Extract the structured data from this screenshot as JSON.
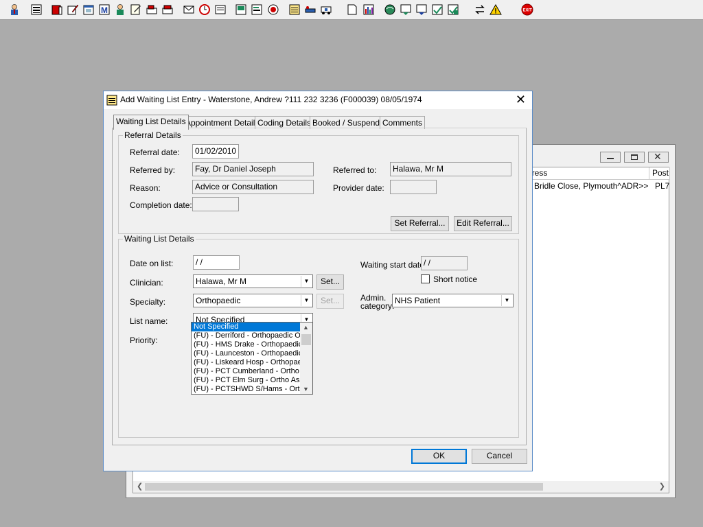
{
  "toolbar": {
    "icons": [
      "patient-icon",
      "print-icon",
      "book-icon",
      "note-edit-icon",
      "calendar-icon",
      "m-icon",
      "doctor-icon",
      "form-icon",
      "fax-icon",
      "phone-icon",
      "envelope-icon",
      "clock-icon",
      "tray-icon",
      "screen-icon",
      "document-icon",
      "record-icon",
      "list-icon",
      "bed-icon",
      "ambulance-icon",
      "page-icon",
      "bar-chart-icon",
      "globe-icon",
      "report-icon",
      "checklist-icon",
      "transfer-icon",
      "swap-icon",
      "warning-icon",
      "exit-icon"
    ],
    "exit_label": "EXIT"
  },
  "background_window": {
    "columns": [
      "dress",
      "Post"
    ],
    "row": {
      "address": "Bridle Close, Plymouth^ADR>>",
      "postcode": "PL7"
    }
  },
  "dialog": {
    "title": "Add Waiting List Entry - Waterstone, Andrew ?111 232 3236 (F000039) 08/05/1974",
    "close": "✕",
    "tabs": [
      "Waiting List Details",
      "Appointment Details",
      "Coding Details",
      "Booked / Suspend",
      "Comments"
    ],
    "referral": {
      "group_title": "Referral Details",
      "referral_date_label": "Referral date:",
      "referral_date": "01/02/2010",
      "referred_by_label": "Referred by:",
      "referred_by": "Fay, Dr Daniel Joseph",
      "referred_to_label": "Referred to:",
      "referred_to": "Halawa, Mr M",
      "reason_label": "Reason:",
      "reason": "Advice or Consultation",
      "provider_date_label": "Provider date:",
      "provider_date": "",
      "completion_date_label": "Completion date:",
      "completion_date": "",
      "set_referral": "Set Referral...",
      "edit_referral": "Edit Referral..."
    },
    "waiting": {
      "group_title": "Waiting List Details",
      "date_on_list_label": "Date on list:",
      "date_on_list": " /  /",
      "waiting_start_label": "Waiting start date:",
      "waiting_start": " /  /",
      "clinician_label": "Clinician:",
      "clinician": "Halawa, Mr M",
      "set_clinician": "Set...",
      "short_notice_label": "Short notice",
      "specialty_label": "Specialty:",
      "specialty": "Orthopaedic",
      "set_specialty": "Set...",
      "admin_category_label_1": "Admin.",
      "admin_category_label_2": "category:",
      "admin_category": "NHS Patient",
      "list_name_label": "List name:",
      "list_name": "Not Specified",
      "priority_label": "Priority:",
      "list_options": [
        "Not Specified",
        "(FU) - Derriford - Orthopaedic OPD",
        "(FU) - HMS Drake - Orthopaedic",
        "(FU) - Launceston - Orthopaedic",
        "(FU) - Liskeard Hosp - Orthopaedic",
        "(FU) - PCT Cumberland - Ortho A",
        "(FU) - PCT Elm Surg - Ortho Asse",
        "(FU) - PCTSHWD S/Hams - Ortho"
      ]
    },
    "ok": "OK",
    "cancel": "Cancel"
  }
}
